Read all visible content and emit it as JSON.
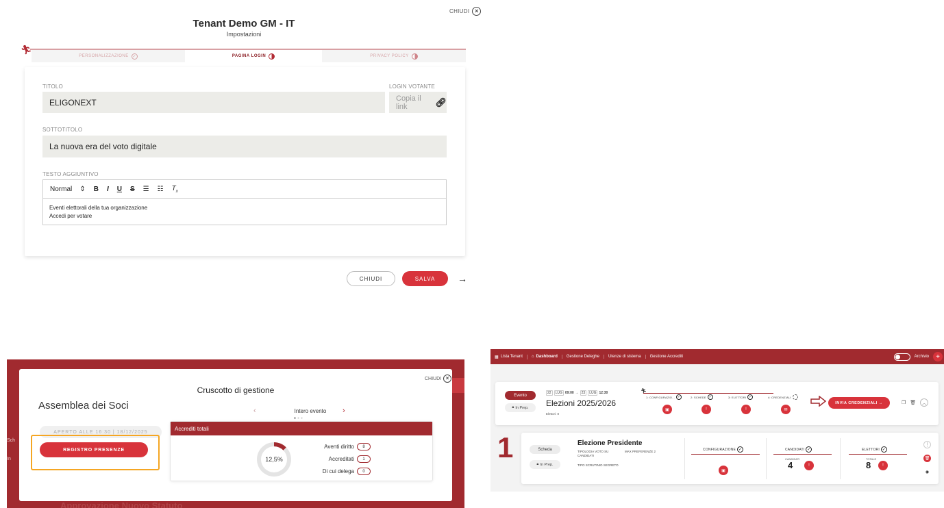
{
  "settings": {
    "close_label": "CHIUDI",
    "title": "Tenant Demo GM - IT",
    "subtitle": "Impostazioni",
    "tabs": [
      {
        "label": "PERSONALIZZAZIONE",
        "state": "done"
      },
      {
        "label": "PAGINA LOGIN",
        "state": "active"
      },
      {
        "label": "PRIVACY POLICY",
        "state": "partial"
      }
    ],
    "titolo_label": "TITOLO",
    "titolo_value": "ELIGONEXT",
    "login_label": "LOGIN VOTANTE",
    "copy_link": "Copia il link",
    "sottotitolo_label": "SOTTOTITOLO",
    "sottotitolo_value": "La nuova era del voto digitale",
    "testo_label": "TESTO AGGIUNTIVO",
    "editor": {
      "format": "Normal",
      "tools": [
        "B",
        "I",
        "U",
        "S"
      ],
      "lines": [
        "Eventi elettorali della tua organizzazione",
        "Accedi per votare"
      ]
    },
    "btn_chiudi": "CHIUDI",
    "btn_salva": "SALVA"
  },
  "cruscotto": {
    "close_label": "CHIUDI",
    "title": "Cruscotto di gestione",
    "assembly": "Assemblea dei Soci",
    "period": "Intero evento",
    "aperto": "APERTO ALLE 16:30 | 18/12/2025",
    "registro": "REGISTRO PRESENZE",
    "accrediti_title": "Accrediti totali",
    "percent": "12,5%",
    "percent_value": 12.5,
    "rows": [
      {
        "label": "Aventi diritto",
        "value": "8"
      },
      {
        "label": "Accreditati",
        "value": "1"
      },
      {
        "label": "Di cui delega",
        "value": "0"
      }
    ],
    "bg_title": "Approvazione Nuovo Statuto",
    "bg_l1": "Sch",
    "bg_l2": "In"
  },
  "dashboard": {
    "nav": [
      "Lista Tenant",
      "Dashboard",
      "Gestione Deleghe",
      "Utenze di sistema",
      "Gestione Accrediti"
    ],
    "archivio": "Archivio",
    "event": {
      "badge": "Evento",
      "status": "In Prep.",
      "start_day": "22",
      "start_month": "LUG",
      "start_time": "09:00",
      "end_day": "23",
      "end_month": "LUG",
      "end_time": "12:30",
      "title": "Elezioni 2025/2026",
      "elettori": "Elettori: 8",
      "steps": [
        "1: CONFIGURAZIO...",
        "2: SCHEDE",
        "3: ELETTORI",
        "4: CREDENZIALI"
      ],
      "invia": "INVIA CREDENZIALI →"
    },
    "scheda": {
      "number": "1",
      "badge": "Scheda",
      "status": "In Prep.",
      "title": "Elezione Presidente",
      "tipologia": "TIPOLOGIA VOTO SU CANDIDATI",
      "max": "MAX PREFERENZE 2",
      "tipo": "TIPO SCRUTINIO SEGRETO",
      "config_label": "CONFIGURAZIONE",
      "candidati_label": "CANDIDATI",
      "candidati_small": "CANDIDATI",
      "candidati_value": "4",
      "elettori_label": "ELETTORI",
      "totale_small": "TOTALE",
      "elettori_value": "8"
    }
  },
  "colors": {
    "brand": "#a12a2f",
    "accent": "#d8333b",
    "highlight": "#f5a623"
  }
}
